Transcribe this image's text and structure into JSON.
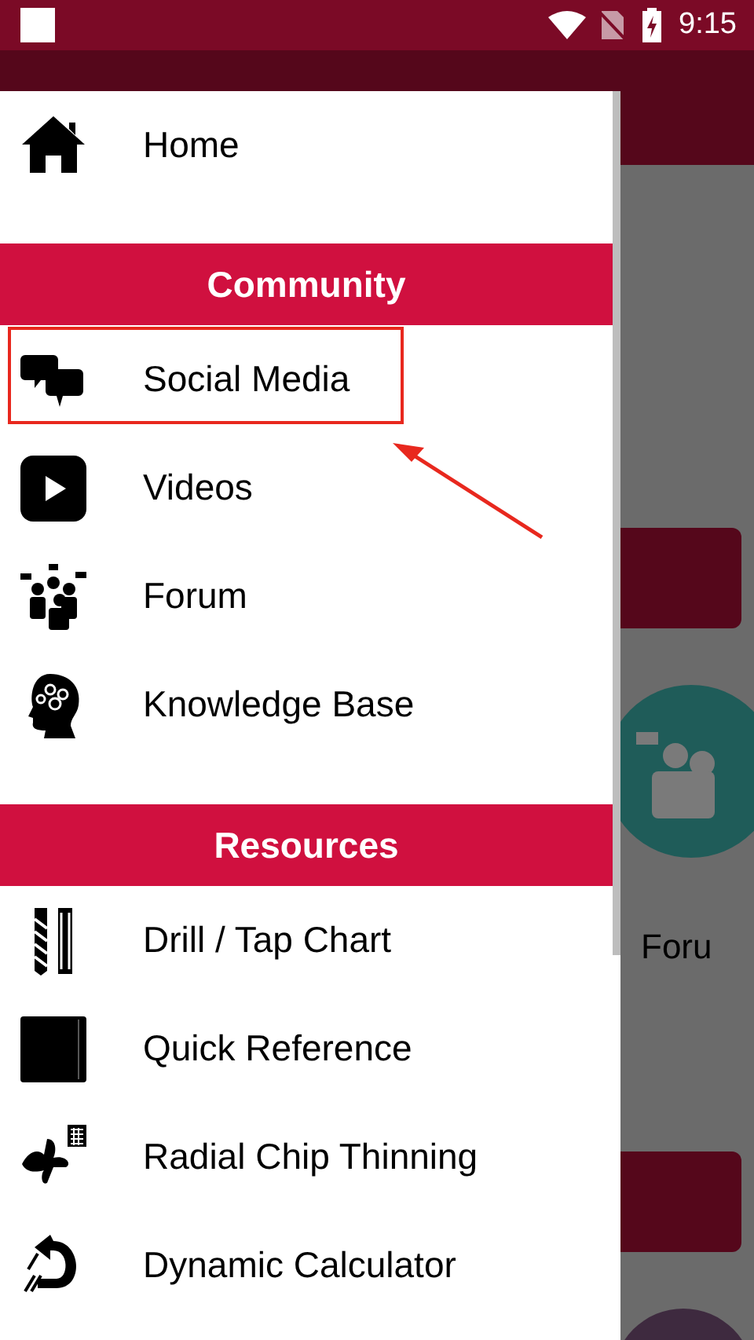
{
  "status_bar": {
    "time": "9:15"
  },
  "drawer": {
    "entries": [
      {
        "kind": "item",
        "label": "Home"
      },
      {
        "kind": "header",
        "label": "Community"
      },
      {
        "kind": "item",
        "label": "Social Media"
      },
      {
        "kind": "item",
        "label": "Videos"
      },
      {
        "kind": "item",
        "label": "Forum"
      },
      {
        "kind": "item",
        "label": "Knowledge Base"
      },
      {
        "kind": "header",
        "label": "Resources"
      },
      {
        "kind": "item",
        "label": "Drill / Tap Chart"
      },
      {
        "kind": "item",
        "label": "Quick Reference"
      },
      {
        "kind": "item",
        "label": "Radial Chip Thinning"
      },
      {
        "kind": "item",
        "label": "Dynamic Calculator"
      }
    ]
  },
  "background": {
    "tile_label": "Foru"
  }
}
